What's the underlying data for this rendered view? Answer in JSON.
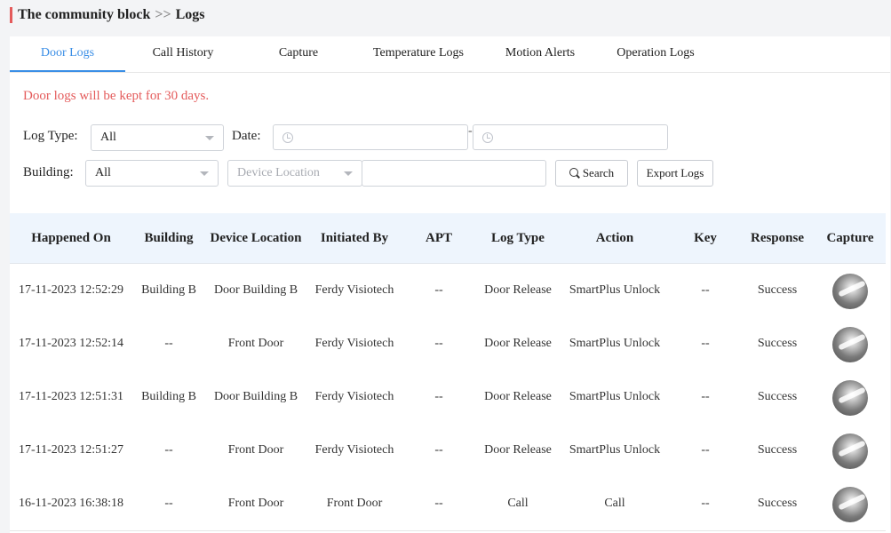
{
  "breadcrumb": {
    "parent": "The community block",
    "separator": ">>",
    "current": "Logs"
  },
  "tabs": [
    {
      "label": "Door Logs",
      "active": true
    },
    {
      "label": "Call History"
    },
    {
      "label": "Capture"
    },
    {
      "label": "Temperature Logs"
    },
    {
      "label": "Motion Alerts"
    },
    {
      "label": "Operation Logs"
    }
  ],
  "notice": "Door logs will be kept for 30 days.",
  "filters": {
    "log_type_label": "Log Type:",
    "log_type_value": "All",
    "date_label": "Date:",
    "date_separator": "-",
    "building_label": "Building:",
    "building_value": "All",
    "device_location_placeholder": "Device Location",
    "search_label": "Search",
    "export_label": "Export Logs"
  },
  "table": {
    "columns": [
      "Happened On",
      "Building",
      "Device Location",
      "Initiated By",
      "APT",
      "Log Type",
      "Action",
      "Key",
      "Response",
      "Capture"
    ],
    "rows": [
      [
        "17-11-2023 12:52:29",
        "Building B",
        "Door Building B",
        "Ferdy Visiotech",
        "--",
        "Door Release",
        "SmartPlus Unlock",
        "--",
        "Success"
      ],
      [
        "17-11-2023 12:52:14",
        "--",
        "Front Door",
        "Ferdy Visiotech",
        "--",
        "Door Release",
        "SmartPlus Unlock",
        "--",
        "Success"
      ],
      [
        "17-11-2023 12:51:31",
        "Building B",
        "Door Building B",
        "Ferdy Visiotech",
        "--",
        "Door Release",
        "SmartPlus Unlock",
        "--",
        "Success"
      ],
      [
        "17-11-2023 12:51:27",
        "--",
        "Front Door",
        "Ferdy Visiotech",
        "--",
        "Door Release",
        "SmartPlus Unlock",
        "--",
        "Success"
      ],
      [
        "16-11-2023 16:38:18",
        "--",
        "Front Door",
        "Front Door",
        "--",
        "Call",
        "Call",
        "--",
        "Success"
      ]
    ]
  },
  "colors": {
    "accent": "#3a8ee6",
    "notice": "#e45b5b",
    "header_bg": "#eef5fd"
  }
}
